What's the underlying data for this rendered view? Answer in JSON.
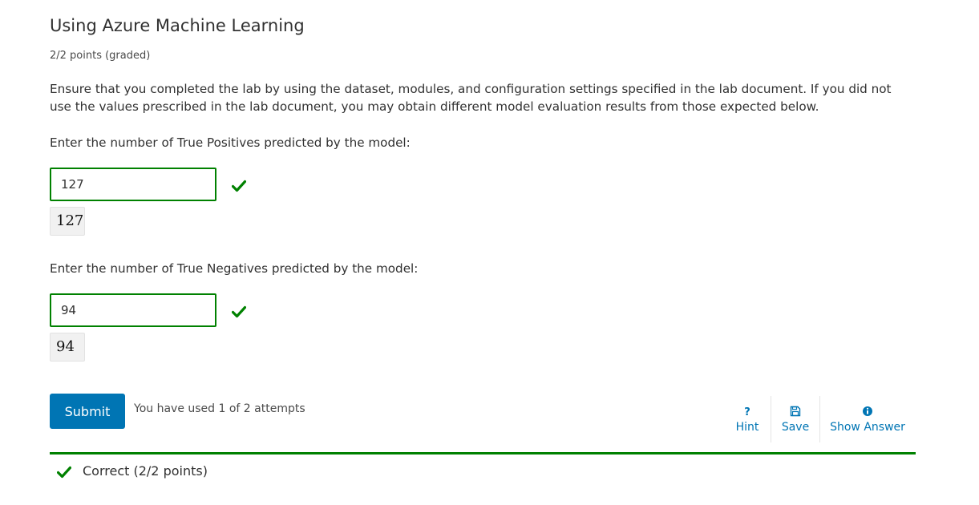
{
  "problem": {
    "title": "Using Azure Machine Learning",
    "points": "2/2 points (graded)",
    "prompt": "Ensure that you completed the lab by using the dataset, modules, and configuration settings specified in the lab document. If you did not use the values prescribed in the lab document, you may obtain different model evaluation results from those expected below."
  },
  "questions": [
    {
      "label": "Enter the number of True Positives predicted by the model:",
      "value": "127",
      "preview": "127",
      "status": "correct"
    },
    {
      "label": "Enter the number of True Negatives predicted by the model:",
      "value": "94",
      "preview": "94",
      "status": "correct"
    }
  ],
  "actions": {
    "submit_label": "Submit",
    "attempts_text": "You have used 1 of 2 attempts",
    "hint_label": "Hint",
    "save_label": "Save",
    "show_answer_label": "Show Answer"
  },
  "status": {
    "text": "Correct (2/2 points)"
  },
  "colors": {
    "correct_green": "#008100",
    "primary_blue": "#0075b4"
  },
  "icons": {
    "hint": "question-icon",
    "save": "floppy-disk-icon",
    "show_answer": "info-circle-icon",
    "correct": "checkmark-icon"
  }
}
